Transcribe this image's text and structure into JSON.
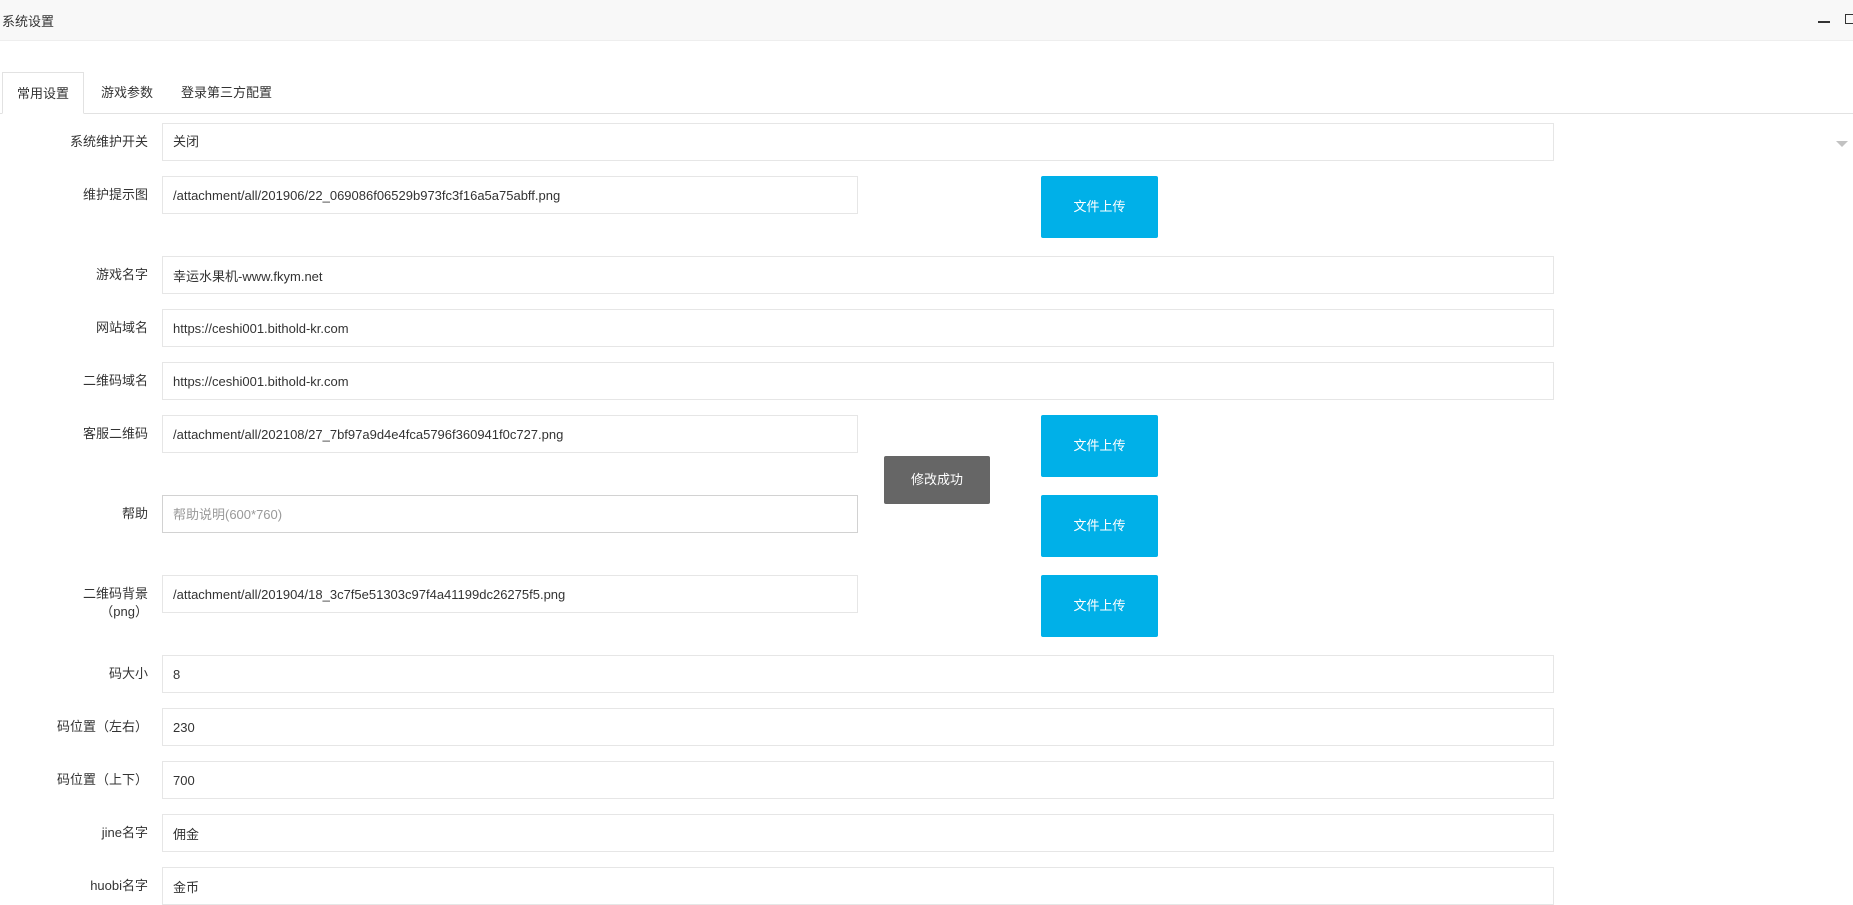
{
  "window": {
    "title": "系统设置",
    "controls": [
      "minimize-icon",
      "maximize-icon"
    ]
  },
  "tabs": [
    {
      "label": "常用设置",
      "active": true
    },
    {
      "label": "游戏参数",
      "active": false
    },
    {
      "label": "登录第三方配置",
      "active": false
    }
  ],
  "form": {
    "maintenance": {
      "label": "系统维护开关",
      "value": "关闭"
    },
    "maintenance_image": {
      "label": "维护提示图",
      "value": "/attachment/all/201906/22_069086f06529b973fc3f16a5a75abff.png",
      "upload": "文件上传"
    },
    "game_name": {
      "label": "游戏名字",
      "value": "幸运水果机-www.fkym.net"
    },
    "site_domain": {
      "label": "网站域名",
      "value": "https://ceshi001.bithold-kr.com"
    },
    "qr_domain": {
      "label": "二维码域名",
      "value": "https://ceshi001.bithold-kr.com"
    },
    "service_qr": {
      "label": "客服二维码",
      "value": "/attachment/all/202108/27_7bf97a9d4e4fca5796f360941f0c727.png",
      "upload": "文件上传"
    },
    "help": {
      "label": "帮助",
      "value": "",
      "placeholder": "帮助说明(600*760)",
      "upload": "文件上传"
    },
    "qr_background": {
      "label_line1": "二维码背景",
      "label_line2": "（png）",
      "value": "/attachment/all/201904/18_3c7f5e51303c97f4a41199dc26275f5.png",
      "upload": "文件上传"
    },
    "code_size": {
      "label": "码大小",
      "value": "8"
    },
    "code_pos_lr": {
      "label": "码位置（左右）",
      "value": "230"
    },
    "code_pos_ud": {
      "label": "码位置（上下）",
      "value": "700"
    },
    "jine_name": {
      "label": "jine名字",
      "value": "佣金"
    },
    "huobi_name": {
      "label": "huobi名字",
      "value": "金币"
    }
  },
  "toast": {
    "text": "修改成功"
  },
  "colors": {
    "upload_button": "#00b0e8",
    "toast_bg": "#666666"
  }
}
